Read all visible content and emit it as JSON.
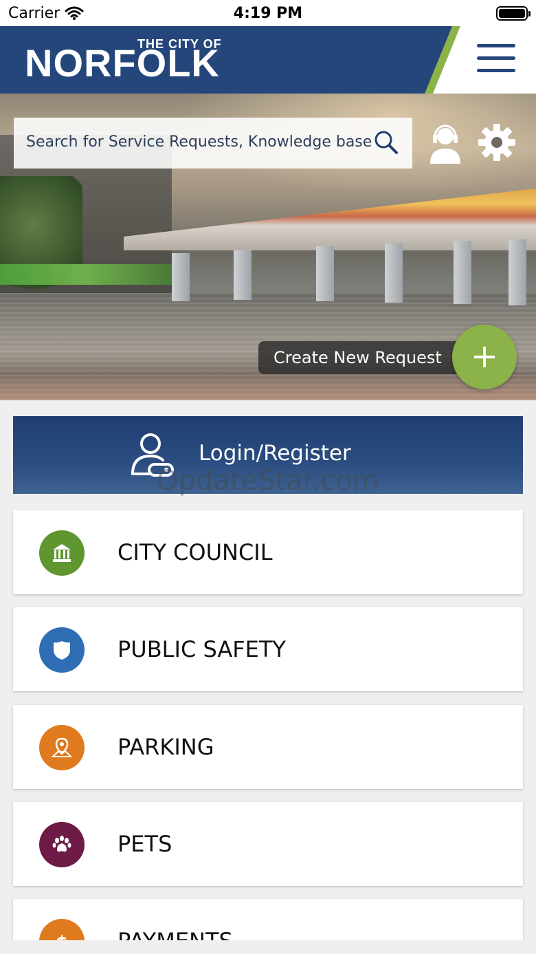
{
  "status_bar": {
    "carrier": "Carrier",
    "time": "4:19 PM"
  },
  "header": {
    "logo_top": "THE CITY OF",
    "logo_main": "NORFOLK",
    "menu_icon": "hamburger-menu-icon"
  },
  "hero": {
    "search_placeholder": "Search for Service Requests, Knowledge base",
    "create_label": "Create New Request"
  },
  "login": {
    "label": "Login/Register"
  },
  "watermark": "OpdateStar.com",
  "categories": [
    {
      "label": "CITY COUNCIL",
      "icon": "city-hall-icon",
      "color": "#5f9630"
    },
    {
      "label": "PUBLIC SAFETY",
      "icon": "police-badge-icon",
      "color": "#2f6db4"
    },
    {
      "label": "PARKING",
      "icon": "map-pin-icon",
      "color": "#e07a1f"
    },
    {
      "label": "PETS",
      "icon": "paw-icon",
      "color": "#6e1a47"
    },
    {
      "label": "PAYMENTS",
      "icon": "dollar-icon",
      "color": "#e07a1f"
    }
  ],
  "colors": {
    "brand_blue": "#24467a",
    "accent_green": "#8bb34a"
  }
}
